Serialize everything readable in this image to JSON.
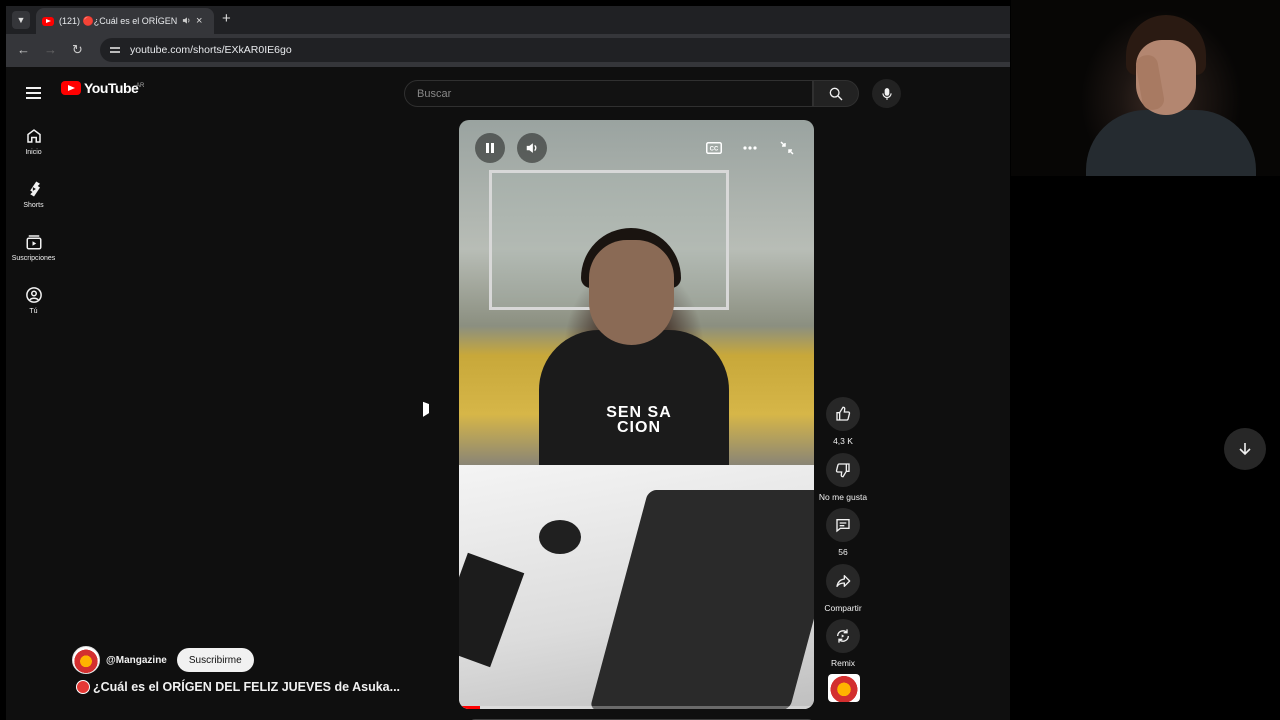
{
  "browser": {
    "tab": {
      "title": "(121) 🔴¿Cuál es el ORÍGEN",
      "audio_icon": "speaker-icon",
      "close": "×"
    },
    "new_tab": "+",
    "nav": {
      "back": "←",
      "forward": "→",
      "reload": "↻"
    },
    "url": "youtube.com/shorts/EXkAR0IE6go"
  },
  "youtube": {
    "logo_text": "YouTube",
    "country_code": "AR",
    "search": {
      "placeholder": "Buscar"
    },
    "guide": [
      {
        "label": "Inicio",
        "icon": "home-icon"
      },
      {
        "label": "Shorts",
        "icon": "shorts-icon"
      },
      {
        "label": "Suscripciones",
        "icon": "subscriptions-icon"
      },
      {
        "label": "Tú",
        "icon": "you-icon"
      }
    ],
    "player": {
      "shirt_text": "SEN SA CION",
      "progress": 0.06
    },
    "actions": {
      "like_count": "4,3 K",
      "dislike_label": "No me gusta",
      "comments_count": "56",
      "share_label": "Compartir",
      "remix_label": "Remix"
    },
    "channel": {
      "handle": "@Mangazine",
      "subscribe_label": "Suscribirme"
    },
    "video_title": "¿Cuál es el ORÍGEN DEL FELIZ JUEVES de Asuka...",
    "colors": {
      "brand_red": "#ff0000",
      "background": "#0f0f0f"
    }
  }
}
